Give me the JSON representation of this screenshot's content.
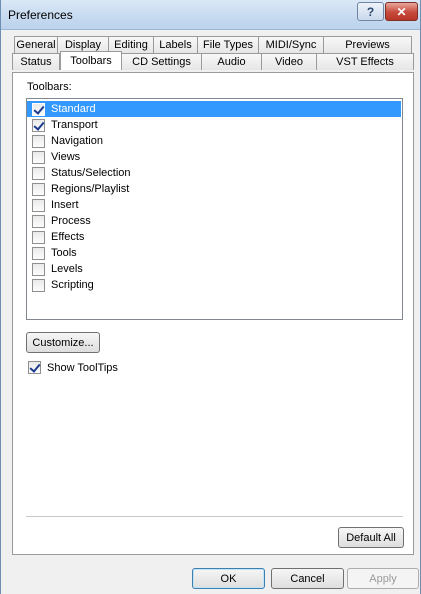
{
  "window": {
    "title": "Preferences",
    "help_glyph": "?",
    "close_glyph": "✕"
  },
  "tabs": {
    "row_back": [
      "General",
      "Display",
      "Editing",
      "Labels",
      "File Types",
      "MIDI/Sync",
      "Previews"
    ],
    "row_front": [
      "Status",
      "Toolbars",
      "CD Settings",
      "Audio",
      "Video",
      "VST Effects"
    ],
    "active": "Toolbars"
  },
  "toolbars": {
    "label": "Toolbars:",
    "items": [
      {
        "label": "Standard",
        "checked": true,
        "selected": true
      },
      {
        "label": "Transport",
        "checked": true,
        "selected": false
      },
      {
        "label": "Navigation",
        "checked": false,
        "selected": false
      },
      {
        "label": "Views",
        "checked": false,
        "selected": false
      },
      {
        "label": "Status/Selection",
        "checked": false,
        "selected": false
      },
      {
        "label": "Regions/Playlist",
        "checked": false,
        "selected": false
      },
      {
        "label": "Insert",
        "checked": false,
        "selected": false
      },
      {
        "label": "Process",
        "checked": false,
        "selected": false
      },
      {
        "label": "Effects",
        "checked": false,
        "selected": false
      },
      {
        "label": "Tools",
        "checked": false,
        "selected": false
      },
      {
        "label": "Levels",
        "checked": false,
        "selected": false
      },
      {
        "label": "Scripting",
        "checked": false,
        "selected": false
      }
    ]
  },
  "customize_label": "Customize...",
  "show_tooltips": {
    "label": "Show ToolTips",
    "checked": true
  },
  "default_all_label": "Default All",
  "footer": {
    "ok": "OK",
    "cancel": "Cancel",
    "apply": "Apply"
  }
}
